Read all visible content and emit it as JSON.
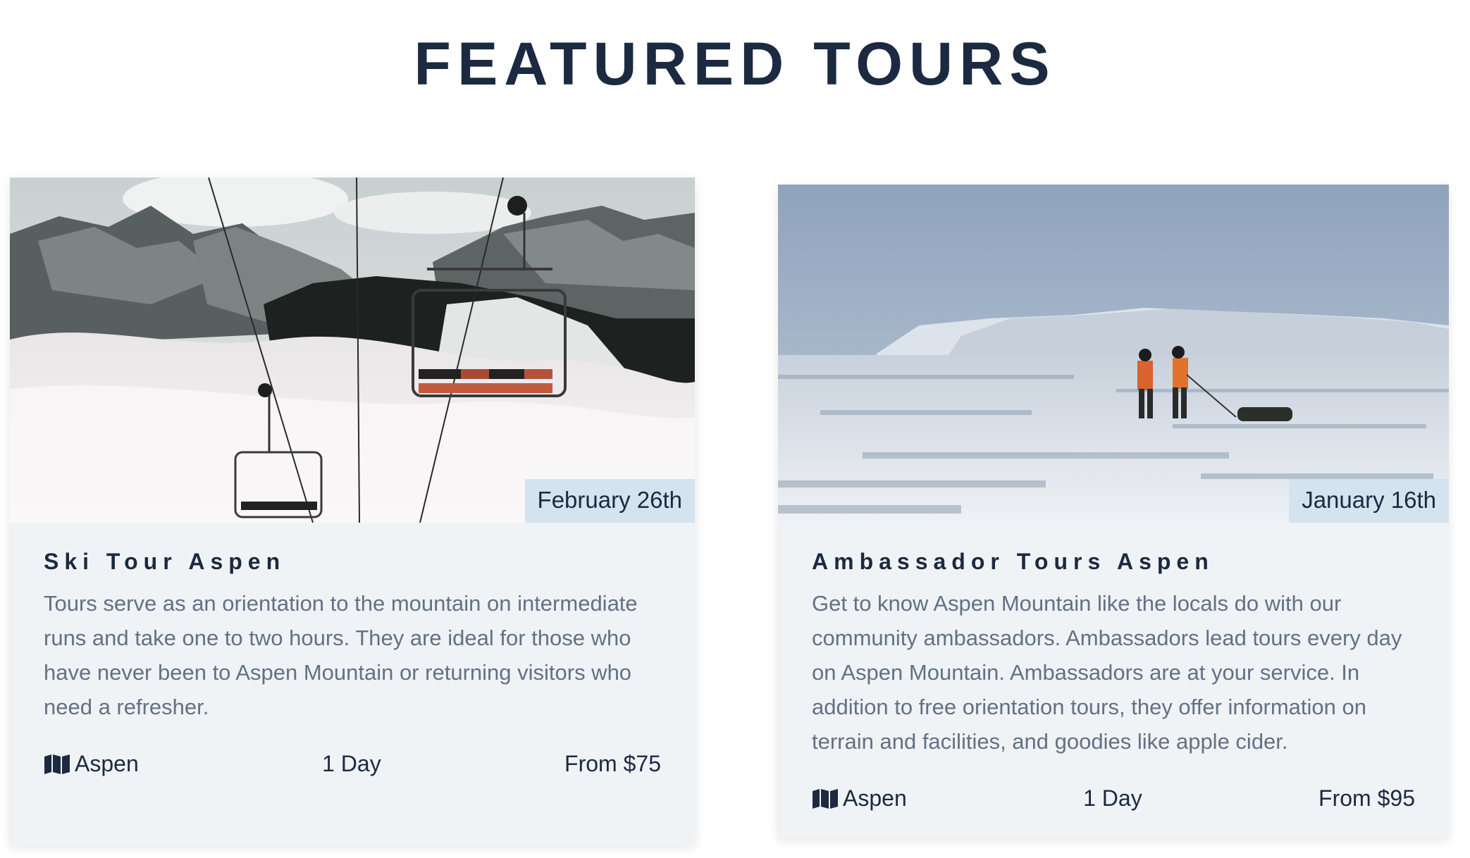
{
  "page": {
    "title": "FEATURED TOURS"
  },
  "tours": [
    {
      "title": "Ski Tour Aspen",
      "date": "February 26th",
      "description": "Tours serve as an orientation to the mountain on intermediate runs and take one to two hours. They are ideal for those who have never been to Aspen Mountain or returning visitors who need a refresher.",
      "location": "Aspen",
      "duration": "1 Day",
      "price": "From $75",
      "location_icon": "map-icon",
      "image": "chairlift-over-clouds-photo"
    },
    {
      "title": "Ambassador Tours Aspen",
      "date": "January 16th",
      "description": "Get to know Aspen Mountain like the locals do with our community ambassadors. Ambassadors lead tours every day on Aspen Mountain. Ambassadors are at your service. In addition to free orientation tours, they offer information on terrain and facilities, and goodies like apple cider.",
      "location": "Aspen",
      "duration": "1 Day",
      "price": "From $95",
      "location_icon": "map-icon",
      "image": "skiers-on-frozen-lake-photo"
    }
  ],
  "colors": {
    "heading": "#1b2a40",
    "card_background": "#f0f3f6",
    "date_badge": "#d5e3ee",
    "body_text": "#627184"
  }
}
